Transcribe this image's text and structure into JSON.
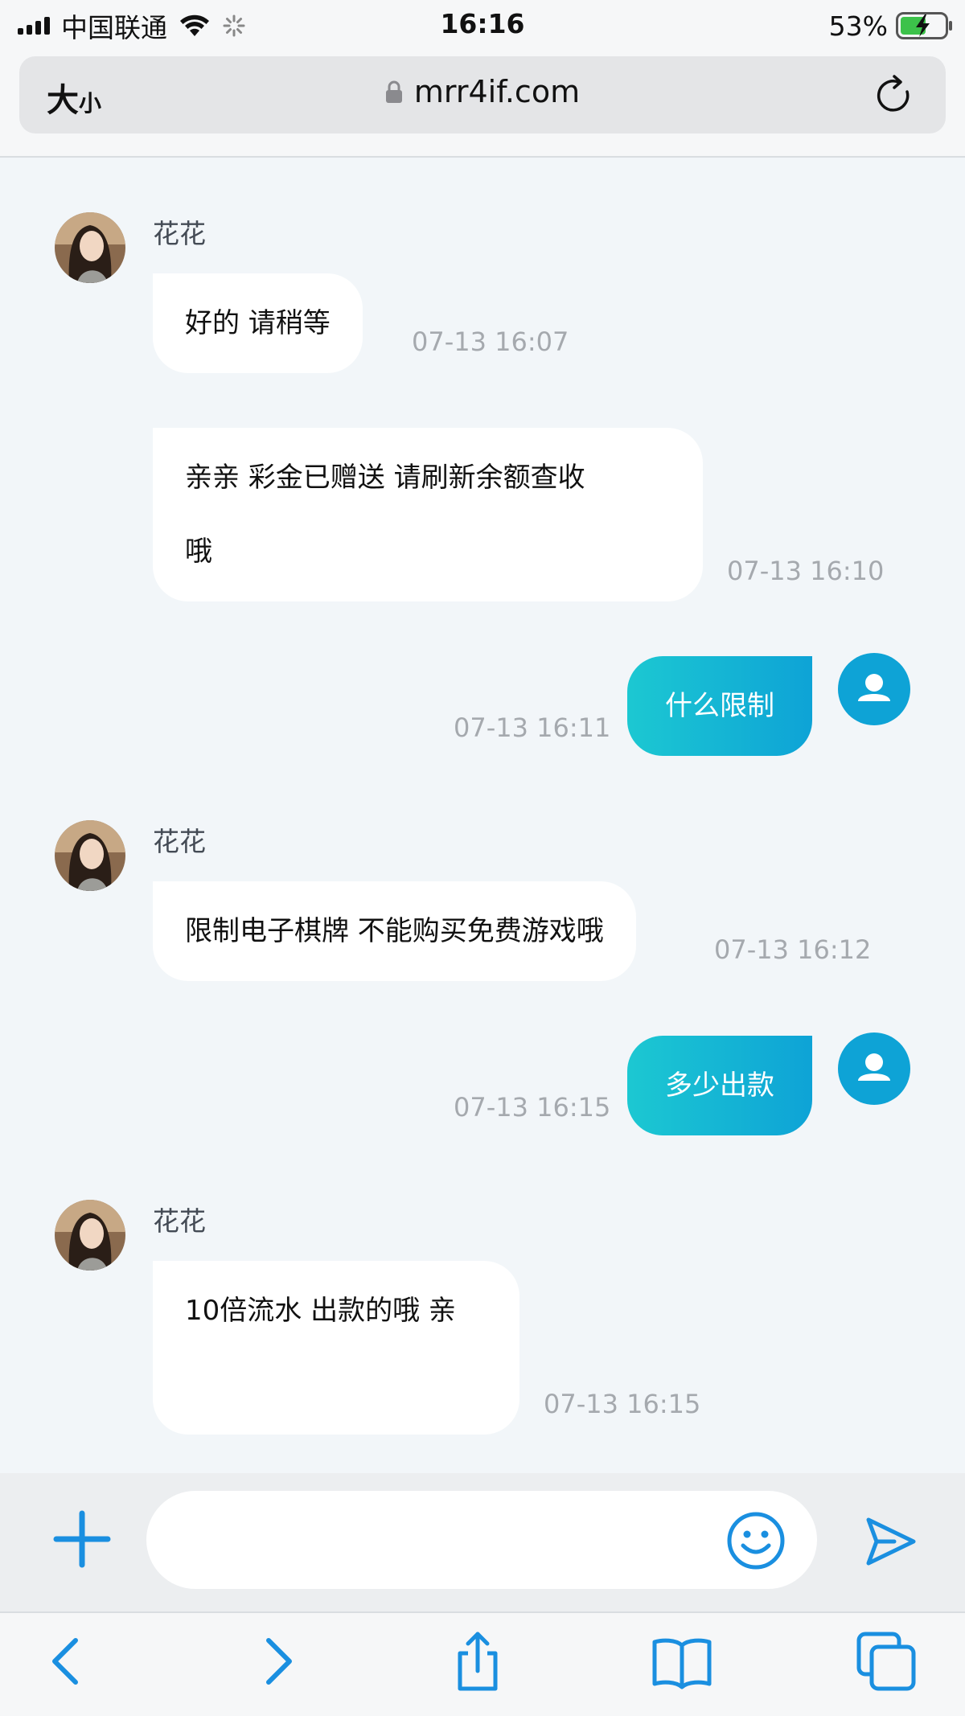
{
  "status_bar": {
    "carrier": "中国联通",
    "time": "16:16",
    "battery_percent": "53%"
  },
  "browser": {
    "text_size_big": "大",
    "text_size_small": "小",
    "url": "mrr4if.com"
  },
  "messages": [
    {
      "direction": "in",
      "sender": "花花",
      "lines": [
        "好的  请稍等"
      ],
      "time": "07-13 16:07"
    },
    {
      "direction": "in",
      "sender": "",
      "lines": [
        "亲亲  彩金已赠送  请刷新余额查收",
        "哦"
      ],
      "time": "07-13 16:10"
    },
    {
      "direction": "out",
      "text": "什么限制",
      "time": "07-13 16:11"
    },
    {
      "direction": "in",
      "sender": "花花",
      "lines": [
        "限制电子棋牌  不能购买免费游戏哦"
      ],
      "time": "07-13 16:12"
    },
    {
      "direction": "out",
      "text": "多少出款",
      "time": "07-13 16:15"
    },
    {
      "direction": "in",
      "sender": "花花",
      "lines": [
        "10倍流水 出款的哦  亲",
        ""
      ],
      "time": "07-13 16:15"
    }
  ],
  "input": {
    "placeholder": "",
    "value": ""
  },
  "colors": {
    "accent": "#0ea3d6",
    "accent_gradient_start": "#1cc8d2",
    "icon_blue": "#1a8fe0",
    "background": "#f2f6f9"
  },
  "icons": {
    "plus": "plus-icon",
    "emoji": "smiley-icon",
    "send": "send-icon",
    "back": "chevron-left-icon",
    "forward": "chevron-right-icon",
    "share": "share-icon",
    "bookmarks": "book-icon",
    "tabs": "tabs-icon"
  }
}
